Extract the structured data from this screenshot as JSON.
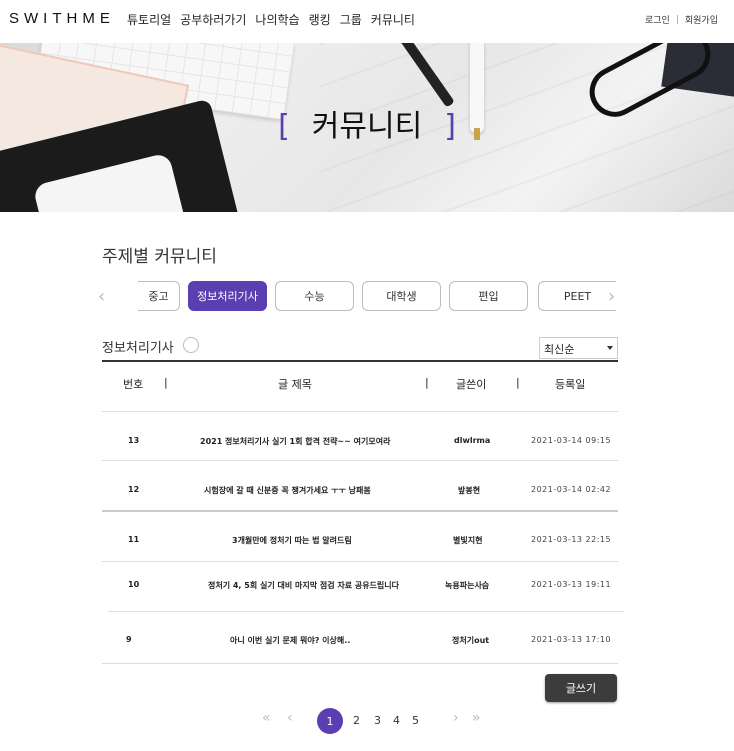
{
  "header": {
    "logo": "SWITHME",
    "nav": [
      "튜토리얼",
      "공부하러가기",
      "나의학습",
      "랭킹",
      "그룹",
      "커뮤니티"
    ],
    "login": "로그인",
    "separator": "|",
    "signup": "회원가입"
  },
  "hero": {
    "bracket_left": "[",
    "title": "커뮤니티",
    "bracket_right": "]"
  },
  "section": {
    "title": "주제별 커뮤니티",
    "categories": [
      "중고",
      "정보처리기사",
      "수능",
      "대학생",
      "편입",
      "PEET"
    ],
    "active_category": "정보처리기사"
  },
  "board": {
    "title": "정보처리기사",
    "sort": "최신순",
    "columns": {
      "num": "번호",
      "title": "글 제목",
      "author": "글쓴이",
      "date": "등록일"
    },
    "col_sep": "|",
    "rows": [
      {
        "num": "13",
        "title": "2021 정보처리기사 실기 1회 합격 전략~~ 여기모여라",
        "author": "dlwlrma",
        "date": "2021-03-14  09:15"
      },
      {
        "num": "12",
        "title": "시험장에 갈 때 신분증 꼭 챙겨가세요 ㅜㅜ 낭패봄",
        "author": "밮봉현",
        "date": "2021-03-14  02:42"
      },
      {
        "num": "11",
        "title": "3개월만에 정처기 따는 법 알려드림",
        "author": "별빛지현",
        "date": "2021-03-13  22:15"
      },
      {
        "num": "10",
        "title": "정처기 4, 5회 실기 대비 마지막 점검 자료 공유드립니다",
        "author": "녹용파는사슴",
        "date": "2021-03-13  19:11"
      },
      {
        "num": "9",
        "title": "아니 이번 실기 문제 뭐야? 이상해..",
        "author": "정처기out",
        "date": "2021-03-13  17:10"
      }
    ],
    "write_button": "글쓰기"
  },
  "pagination": {
    "first": "«",
    "prev": "‹",
    "pages": [
      "1",
      "2",
      "3",
      "4",
      "5"
    ],
    "current": "1",
    "next": "›",
    "last": "»"
  },
  "colors": {
    "accent": "#5b3fb0",
    "button_dark": "#3c3c3c"
  }
}
